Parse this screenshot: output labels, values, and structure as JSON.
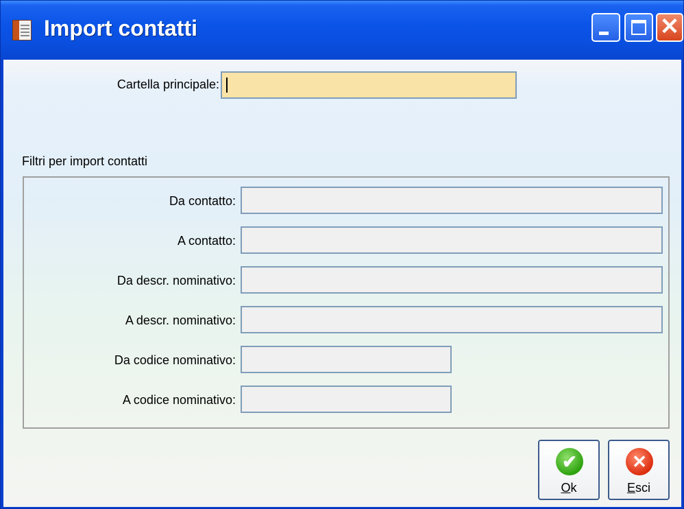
{
  "window": {
    "title": "Import contatti",
    "icon": "document-icon",
    "controls": {
      "minimize": "minimize-icon",
      "maximize": "maximize-icon",
      "close": "close-icon",
      "close_glyph": "✕"
    }
  },
  "main": {
    "folder_label": "Cartella principale:",
    "folder_value": "",
    "filters_title": "Filtri per import contatti",
    "filters": [
      {
        "label": "Da contatto:",
        "value": ""
      },
      {
        "label": "A contatto:",
        "value": ""
      },
      {
        "label": "Da descr. nominativo:",
        "value": ""
      },
      {
        "label": "A descr. nominativo:",
        "value": ""
      },
      {
        "label": "Da codice nominativo:",
        "value": ""
      },
      {
        "label": "A codice nominativo:",
        "value": ""
      }
    ]
  },
  "buttons": {
    "ok": {
      "mnemonic": "O",
      "rest": "k",
      "icon": "check-icon",
      "glyph": "✔"
    },
    "esci": {
      "mnemonic": "E",
      "rest": "sci",
      "icon": "cancel-icon",
      "glyph": "✕"
    }
  },
  "colors": {
    "title_bar": "#0b54e8",
    "required_field": "#fae3a6",
    "field_bg": "#f0f0f0",
    "field_border": "#7f9db9"
  }
}
